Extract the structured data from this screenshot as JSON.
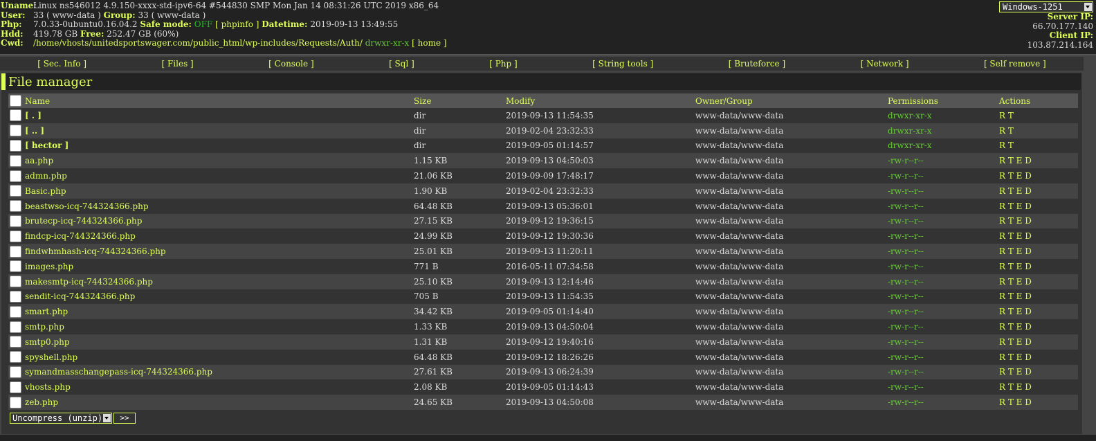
{
  "header": {
    "uname_label": "Uname:",
    "uname": "Linux ns546012 4.9.150-xxxx-std-ipv6-64 #544830 SMP Mon Jan 14 08:31:26 UTC 2019 x86_64",
    "user_label": "User:",
    "user_value": "33 ( www-data )",
    "group_label": "Group:",
    "group_value": "33 ( www-data )",
    "php_label": "Php:",
    "php_version": "7.0.33-0ubuntu0.16.04.2",
    "safe_mode_label": "Safe mode:",
    "safe_mode_value": "OFF",
    "phpinfo_link": "[ phpinfo ]",
    "datetime_label": "Datetime:",
    "datetime_value": "2019-09-13 13:49:55",
    "hdd_label": "Hdd:",
    "hdd_value": "419.78 GB",
    "free_label": "Free:",
    "free_value": "252.47 GB (60%)",
    "cwd_label": "Cwd:",
    "cwd_path": "/home/vhosts/unitedsportswager.com/public_html/wp-includes/Requests/Auth/",
    "cwd_perms": "drwxr-xr-x",
    "home_link": "[ home ]",
    "charset_select": "Windows-1251",
    "server_ip_label": "Server IP:",
    "server_ip": "66.70.177.140",
    "client_ip_label": "Client IP:",
    "client_ip": "103.87.214.164"
  },
  "menu": [
    "[ Sec. Info ]",
    "[ Files ]",
    "[ Console ]",
    "[ Sql ]",
    "[ Php ]",
    "[ String tools ]",
    "[ Bruteforce ]",
    "[ Network ]",
    "[ Self remove ]"
  ],
  "file_manager": {
    "title": "File manager",
    "columns": [
      "Name",
      "Size",
      "Modify",
      "Owner/Group",
      "Permissions",
      "Actions"
    ],
    "rows": [
      {
        "name": "[ . ]",
        "size": "dir",
        "modify": "2019-09-13 11:54:35",
        "owner": "www-data/www-data",
        "perms": "drwxr-xr-x",
        "actions": "R T",
        "is_dir": true
      },
      {
        "name": "[ .. ]",
        "size": "dir",
        "modify": "2019-02-04 23:32:33",
        "owner": "www-data/www-data",
        "perms": "drwxr-xr-x",
        "actions": "R T",
        "is_dir": true
      },
      {
        "name": "[ hector ]",
        "size": "dir",
        "modify": "2019-09-05 01:14:57",
        "owner": "www-data/www-data",
        "perms": "drwxr-xr-x",
        "actions": "R T",
        "is_dir": true
      },
      {
        "name": "aa.php",
        "size": "1.15 KB",
        "modify": "2019-09-13 04:50:03",
        "owner": "www-data/www-data",
        "perms": "-rw-r--r--",
        "actions": "R T E D",
        "is_dir": false
      },
      {
        "name": "admn.php",
        "size": "21.06 KB",
        "modify": "2019-09-09 17:48:17",
        "owner": "www-data/www-data",
        "perms": "-rw-r--r--",
        "actions": "R T E D",
        "is_dir": false
      },
      {
        "name": "Basic.php",
        "size": "1.90 KB",
        "modify": "2019-02-04 23:32:33",
        "owner": "www-data/www-data",
        "perms": "-rw-r--r--",
        "actions": "R T E D",
        "is_dir": false
      },
      {
        "name": "beastwso-icq-744324366.php",
        "size": "64.48 KB",
        "modify": "2019-09-13 05:36:01",
        "owner": "www-data/www-data",
        "perms": "-rw-r--r--",
        "actions": "R T E D",
        "is_dir": false
      },
      {
        "name": "brutecp-icq-744324366.php",
        "size": "27.15 KB",
        "modify": "2019-09-12 19:36:15",
        "owner": "www-data/www-data",
        "perms": "-rw-r--r--",
        "actions": "R T E D",
        "is_dir": false
      },
      {
        "name": "findcp-icq-744324366.php",
        "size": "24.99 KB",
        "modify": "2019-09-12 19:30:36",
        "owner": "www-data/www-data",
        "perms": "-rw-r--r--",
        "actions": "R T E D",
        "is_dir": false
      },
      {
        "name": "findwhmhash-icq-744324366.php",
        "size": "25.01 KB",
        "modify": "2019-09-13 11:20:11",
        "owner": "www-data/www-data",
        "perms": "-rw-r--r--",
        "actions": "R T E D",
        "is_dir": false
      },
      {
        "name": "images.php",
        "size": "771 B",
        "modify": "2016-05-11 07:34:58",
        "owner": "www-data/www-data",
        "perms": "-rw-r--r--",
        "actions": "R T E D",
        "is_dir": false
      },
      {
        "name": "makesmtp-icq-744324366.php",
        "size": "25.10 KB",
        "modify": "2019-09-13 12:14:46",
        "owner": "www-data/www-data",
        "perms": "-rw-r--r--",
        "actions": "R T E D",
        "is_dir": false
      },
      {
        "name": "sendit-icq-744324366.php",
        "size": "705 B",
        "modify": "2019-09-13 11:54:35",
        "owner": "www-data/www-data",
        "perms": "-rw-r--r--",
        "actions": "R T E D",
        "is_dir": false
      },
      {
        "name": "smart.php",
        "size": "34.42 KB",
        "modify": "2019-09-05 01:14:40",
        "owner": "www-data/www-data",
        "perms": "-rw-r--r--",
        "actions": "R T E D",
        "is_dir": false
      },
      {
        "name": "smtp.php",
        "size": "1.33 KB",
        "modify": "2019-09-13 04:50:04",
        "owner": "www-data/www-data",
        "perms": "-rw-r--r--",
        "actions": "R T E D",
        "is_dir": false
      },
      {
        "name": "smtp0.php",
        "size": "1.31 KB",
        "modify": "2019-09-12 19:40:16",
        "owner": "www-data/www-data",
        "perms": "-rw-r--r--",
        "actions": "R T E D",
        "is_dir": false
      },
      {
        "name": "spyshell.php",
        "size": "64.48 KB",
        "modify": "2019-09-12 18:26:26",
        "owner": "www-data/www-data",
        "perms": "-rw-r--r--",
        "actions": "R T E D",
        "is_dir": false
      },
      {
        "name": "symandmasschangepass-icq-744324366.php",
        "size": "27.61 KB",
        "modify": "2019-09-13 06:24:39",
        "owner": "www-data/www-data",
        "perms": "-rw-r--r--",
        "actions": "R T E D",
        "is_dir": false
      },
      {
        "name": "vhosts.php",
        "size": "2.08 KB",
        "modify": "2019-09-05 01:14:43",
        "owner": "www-data/www-data",
        "perms": "-rw-r--r--",
        "actions": "R T E D",
        "is_dir": false
      },
      {
        "name": "zeb.php",
        "size": "24.65 KB",
        "modify": "2019-09-13 04:50:08",
        "owner": "www-data/www-data",
        "perms": "-rw-r--r--",
        "actions": "R T E D",
        "is_dir": false
      }
    ],
    "bulk_action_select": "Uncompress (unzip)",
    "go_button": ">>"
  },
  "colors": {
    "accent": "#ddff55",
    "perm_green": "#66cc33",
    "safe_mode_off": "#22bb22",
    "background": "#444444"
  }
}
